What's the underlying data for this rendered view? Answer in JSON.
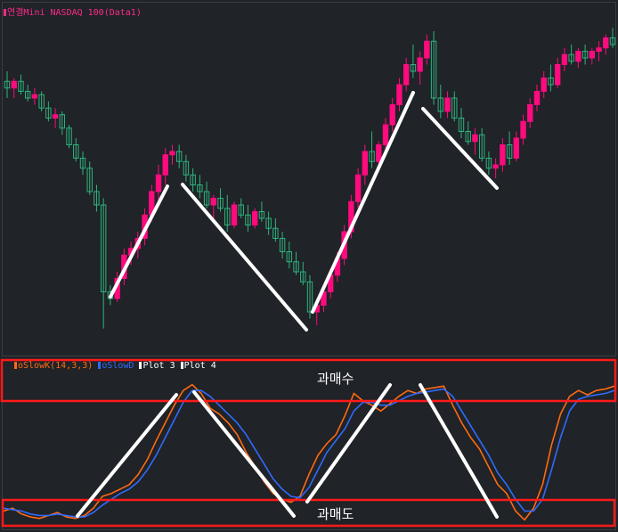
{
  "colors": {
    "background": "#202327",
    "up": "#ff0a7f",
    "down": "#2db47e",
    "slowk": "#ff6a14",
    "slowd": "#2f6bff",
    "zone_box": "#ff1a1a",
    "trend": "#ffffff"
  },
  "price_panel": {
    "legend": "연결Mini NASDAQ 100(Data1)"
  },
  "stoch_panel": {
    "legend_items": [
      {
        "label": "oSlowK(14,3,3)",
        "color": "#ff6a14"
      },
      {
        "label": "oSlowD",
        "color": "#2f6bff"
      },
      {
        "label": "Plot 3",
        "color": "#ffffff"
      },
      {
        "label": "Plot 4",
        "color": "#ffffff"
      }
    ],
    "overbought_label": "과매수",
    "oversold_label": "과매도"
  },
  "chart_data": [
    {
      "type": "candlestick",
      "title": "연결Mini NASDAQ 100(Data1)",
      "ylim": [
        0,
        100
      ],
      "note_values": "approximate relative price levels (no axis printed)",
      "candles": [
        {
          "o": 81,
          "h": 84,
          "l": 76,
          "c": 79
        },
        {
          "o": 79,
          "h": 82,
          "l": 76,
          "c": 81
        },
        {
          "o": 81,
          "h": 83,
          "l": 77,
          "c": 78
        },
        {
          "o": 78,
          "h": 80,
          "l": 75,
          "c": 76
        },
        {
          "o": 76,
          "h": 79,
          "l": 74,
          "c": 77
        },
        {
          "o": 77,
          "h": 78,
          "l": 72,
          "c": 73
        },
        {
          "o": 73,
          "h": 75,
          "l": 69,
          "c": 70
        },
        {
          "o": 70,
          "h": 73,
          "l": 67,
          "c": 71
        },
        {
          "o": 71,
          "h": 72,
          "l": 65,
          "c": 67
        },
        {
          "o": 67,
          "h": 68,
          "l": 61,
          "c": 62
        },
        {
          "o": 62,
          "h": 64,
          "l": 57,
          "c": 58
        },
        {
          "o": 58,
          "h": 60,
          "l": 53,
          "c": 55
        },
        {
          "o": 55,
          "h": 57,
          "l": 47,
          "c": 48
        },
        {
          "o": 48,
          "h": 50,
          "l": 42,
          "c": 44
        },
        {
          "o": 44,
          "h": 46,
          "l": 7,
          "c": 18
        },
        {
          "o": 18,
          "h": 20,
          "l": 14,
          "c": 16
        },
        {
          "o": 16,
          "h": 24,
          "l": 15,
          "c": 22
        },
        {
          "o": 22,
          "h": 31,
          "l": 20,
          "c": 29
        },
        {
          "o": 29,
          "h": 33,
          "l": 26,
          "c": 31
        },
        {
          "o": 31,
          "h": 36,
          "l": 28,
          "c": 34
        },
        {
          "o": 34,
          "h": 43,
          "l": 32,
          "c": 41
        },
        {
          "o": 41,
          "h": 50,
          "l": 39,
          "c": 48
        },
        {
          "o": 48,
          "h": 56,
          "l": 45,
          "c": 53
        },
        {
          "o": 53,
          "h": 61,
          "l": 50,
          "c": 59
        },
        {
          "o": 59,
          "h": 62,
          "l": 56,
          "c": 60
        },
        {
          "o": 60,
          "h": 62,
          "l": 55,
          "c": 57
        },
        {
          "o": 57,
          "h": 59,
          "l": 51,
          "c": 53
        },
        {
          "o": 53,
          "h": 55,
          "l": 48,
          "c": 50
        },
        {
          "o": 50,
          "h": 53,
          "l": 46,
          "c": 48
        },
        {
          "o": 48,
          "h": 51,
          "l": 43,
          "c": 44
        },
        {
          "o": 44,
          "h": 47,
          "l": 40,
          "c": 46
        },
        {
          "o": 46,
          "h": 49,
          "l": 42,
          "c": 43
        },
        {
          "o": 43,
          "h": 47,
          "l": 36,
          "c": 38
        },
        {
          "o": 38,
          "h": 45,
          "l": 37,
          "c": 44
        },
        {
          "o": 44,
          "h": 46,
          "l": 40,
          "c": 41
        },
        {
          "o": 41,
          "h": 44,
          "l": 36,
          "c": 38
        },
        {
          "o": 38,
          "h": 43,
          "l": 37,
          "c": 42
        },
        {
          "o": 42,
          "h": 45,
          "l": 39,
          "c": 40
        },
        {
          "o": 40,
          "h": 42,
          "l": 35,
          "c": 37
        },
        {
          "o": 37,
          "h": 40,
          "l": 33,
          "c": 34
        },
        {
          "o": 34,
          "h": 36,
          "l": 28,
          "c": 30
        },
        {
          "o": 30,
          "h": 33,
          "l": 25,
          "c": 27
        },
        {
          "o": 27,
          "h": 30,
          "l": 23,
          "c": 24
        },
        {
          "o": 24,
          "h": 27,
          "l": 20,
          "c": 21
        },
        {
          "o": 21,
          "h": 23,
          "l": 10,
          "c": 12
        },
        {
          "o": 12,
          "h": 16,
          "l": 8,
          "c": 14
        },
        {
          "o": 14,
          "h": 20,
          "l": 12,
          "c": 18
        },
        {
          "o": 18,
          "h": 25,
          "l": 16,
          "c": 23
        },
        {
          "o": 23,
          "h": 30,
          "l": 21,
          "c": 28
        },
        {
          "o": 28,
          "h": 38,
          "l": 26,
          "c": 36
        },
        {
          "o": 36,
          "h": 47,
          "l": 34,
          "c": 45
        },
        {
          "o": 45,
          "h": 55,
          "l": 43,
          "c": 53
        },
        {
          "o": 53,
          "h": 62,
          "l": 50,
          "c": 60
        },
        {
          "o": 60,
          "h": 66,
          "l": 55,
          "c": 57
        },
        {
          "o": 57,
          "h": 63,
          "l": 54,
          "c": 62
        },
        {
          "o": 62,
          "h": 70,
          "l": 60,
          "c": 68
        },
        {
          "o": 68,
          "h": 76,
          "l": 66,
          "c": 74
        },
        {
          "o": 74,
          "h": 82,
          "l": 72,
          "c": 80
        },
        {
          "o": 80,
          "h": 88,
          "l": 78,
          "c": 86
        },
        {
          "o": 86,
          "h": 92,
          "l": 82,
          "c": 84
        },
        {
          "o": 84,
          "h": 90,
          "l": 80,
          "c": 88
        },
        {
          "o": 88,
          "h": 95,
          "l": 86,
          "c": 93
        },
        {
          "o": 93,
          "h": 96,
          "l": 74,
          "c": 76
        },
        {
          "o": 76,
          "h": 80,
          "l": 70,
          "c": 72
        },
        {
          "o": 72,
          "h": 78,
          "l": 70,
          "c": 76
        },
        {
          "o": 76,
          "h": 78,
          "l": 69,
          "c": 70
        },
        {
          "o": 70,
          "h": 73,
          "l": 64,
          "c": 66
        },
        {
          "o": 66,
          "h": 69,
          "l": 62,
          "c": 63
        },
        {
          "o": 63,
          "h": 67,
          "l": 59,
          "c": 65
        },
        {
          "o": 65,
          "h": 67,
          "l": 57,
          "c": 58
        },
        {
          "o": 58,
          "h": 60,
          "l": 53,
          "c": 55
        },
        {
          "o": 55,
          "h": 58,
          "l": 52,
          "c": 56
        },
        {
          "o": 56,
          "h": 64,
          "l": 54,
          "c": 62
        },
        {
          "o": 62,
          "h": 66,
          "l": 56,
          "c": 58
        },
        {
          "o": 58,
          "h": 66,
          "l": 57,
          "c": 64
        },
        {
          "o": 64,
          "h": 71,
          "l": 62,
          "c": 69
        },
        {
          "o": 69,
          "h": 76,
          "l": 67,
          "c": 74
        },
        {
          "o": 74,
          "h": 80,
          "l": 72,
          "c": 78
        },
        {
          "o": 78,
          "h": 84,
          "l": 76,
          "c": 82
        },
        {
          "o": 82,
          "h": 86,
          "l": 78,
          "c": 80
        },
        {
          "o": 80,
          "h": 88,
          "l": 79,
          "c": 86
        },
        {
          "o": 86,
          "h": 91,
          "l": 84,
          "c": 89
        },
        {
          "o": 89,
          "h": 92,
          "l": 86,
          "c": 87
        },
        {
          "o": 87,
          "h": 91,
          "l": 85,
          "c": 90
        },
        {
          "o": 90,
          "h": 92,
          "l": 86,
          "c": 88
        },
        {
          "o": 88,
          "h": 91,
          "l": 86,
          "c": 90
        },
        {
          "o": 90,
          "h": 93,
          "l": 87,
          "c": 91
        },
        {
          "o": 91,
          "h": 95,
          "l": 89,
          "c": 94
        },
        {
          "o": 94,
          "h": 97,
          "l": 91,
          "c": 92
        }
      ]
    },
    {
      "type": "line",
      "title": "",
      "ylim": [
        0,
        100
      ],
      "series": [
        {
          "name": "oSlowK(14,3,3)",
          "color": "#ff6a14",
          "values": [
            10,
            12,
            8,
            6,
            5,
            7,
            9,
            6,
            5,
            7,
            12,
            20,
            22,
            25,
            28,
            35,
            45,
            58,
            70,
            82,
            92,
            96,
            90,
            80,
            76,
            70,
            62,
            50,
            40,
            30,
            22,
            18,
            16,
            20,
            35,
            48,
            56,
            62,
            75,
            90,
            85,
            82,
            78,
            83,
            88,
            92,
            90,
            93,
            94,
            95,
            82,
            70,
            60,
            52,
            40,
            28,
            22,
            10,
            4,
            12,
            28,
            55,
            76,
            88,
            92,
            89,
            92,
            93,
            95
          ]
        },
        {
          "name": "oSlowD",
          "color": "#2f6bff",
          "values": [
            12,
            11,
            10,
            8,
            7,
            7,
            8,
            7,
            6,
            6,
            9,
            14,
            18,
            22,
            25,
            30,
            38,
            48,
            60,
            72,
            84,
            92,
            92,
            88,
            82,
            76,
            70,
            62,
            52,
            42,
            32,
            25,
            20,
            19,
            26,
            38,
            50,
            58,
            66,
            78,
            84,
            84,
            82,
            82,
            85,
            88,
            90,
            91,
            92,
            93,
            88,
            78,
            68,
            58,
            48,
            36,
            28,
            18,
            10,
            10,
            18,
            38,
            60,
            78,
            86,
            88,
            89,
            90,
            92
          ]
        }
      ]
    }
  ]
}
